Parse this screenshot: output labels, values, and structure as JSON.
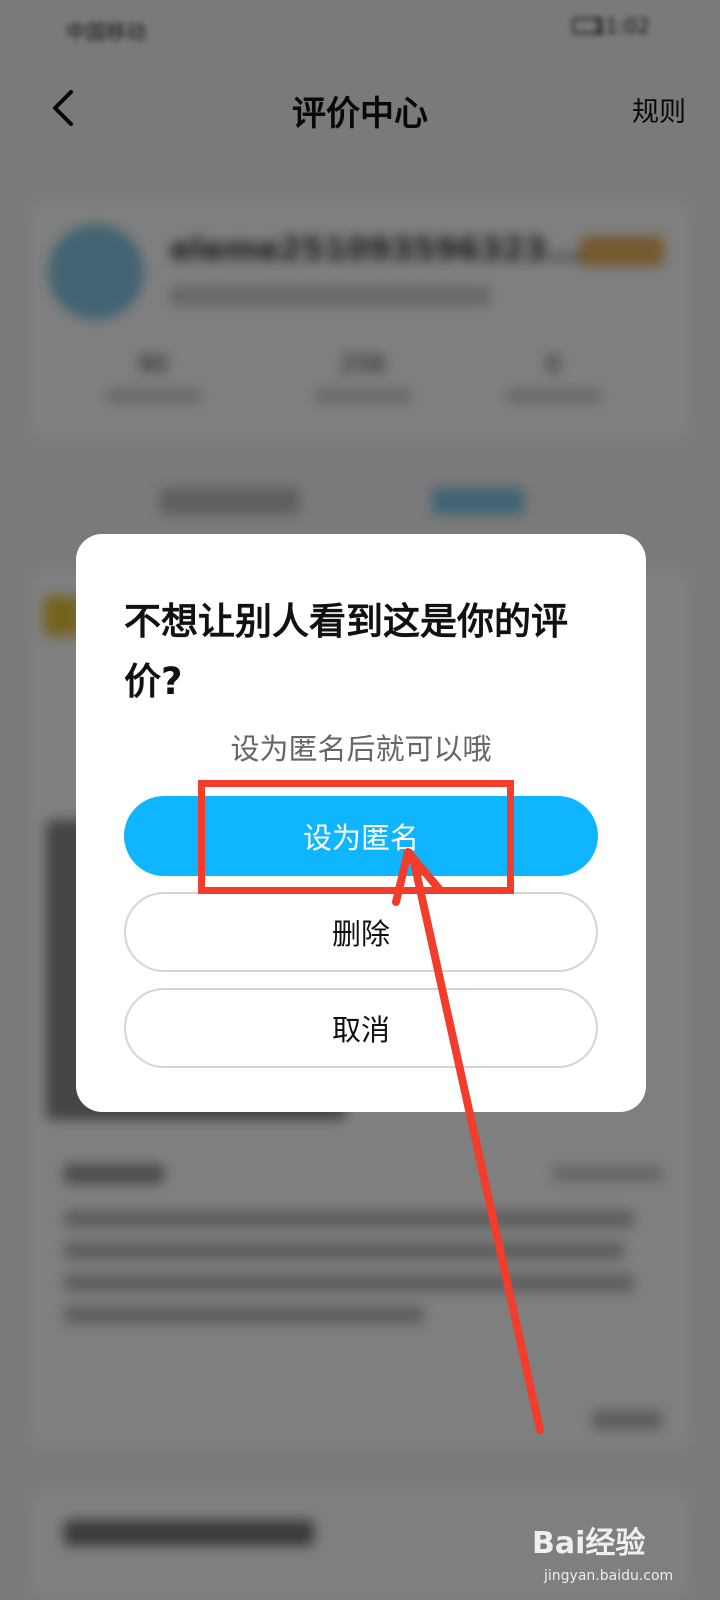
{
  "status_bar": {
    "carrier": "中国移动",
    "time": "11:02"
  },
  "nav": {
    "title": "评价中心",
    "rules_label": "规则",
    "back_icon": "chevron-left-icon"
  },
  "profile": {
    "username": "eleme251093596323...",
    "stats": [
      "90",
      "256",
      "0"
    ]
  },
  "dialog": {
    "title": "不想让别人看到这是你的评价?",
    "subtitle": "设为匿名后就可以哦",
    "anonymous_label": "设为匿名",
    "delete_label": "删除",
    "cancel_label": "取消"
  },
  "watermark": {
    "logo": "Bai经验",
    "site": "jingyan.baidu.com"
  },
  "colors": {
    "primary_button": "#0fb6ff",
    "annotation_red": "#f23c2c",
    "overlay": "rgba(0,0,0,0.5)"
  }
}
